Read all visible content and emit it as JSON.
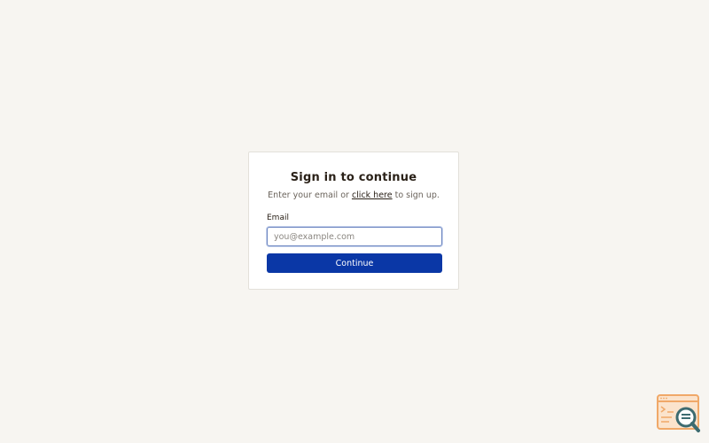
{
  "signin": {
    "title": "Sign in to continue",
    "subtitle_prefix": "Enter your email or ",
    "subtitle_link": "click here",
    "subtitle_suffix": " to sign up.",
    "email_label": "Email",
    "email_placeholder": "you@example.com",
    "email_value": "",
    "continue_label": "Continue"
  },
  "corner_logo": {
    "icon": "browser-search-logo-icon"
  },
  "colors": {
    "background": "#f7f5f1",
    "primary_button": "#0a37a6",
    "logo_orange": "#f0a868",
    "logo_teal": "#3d6b70"
  }
}
